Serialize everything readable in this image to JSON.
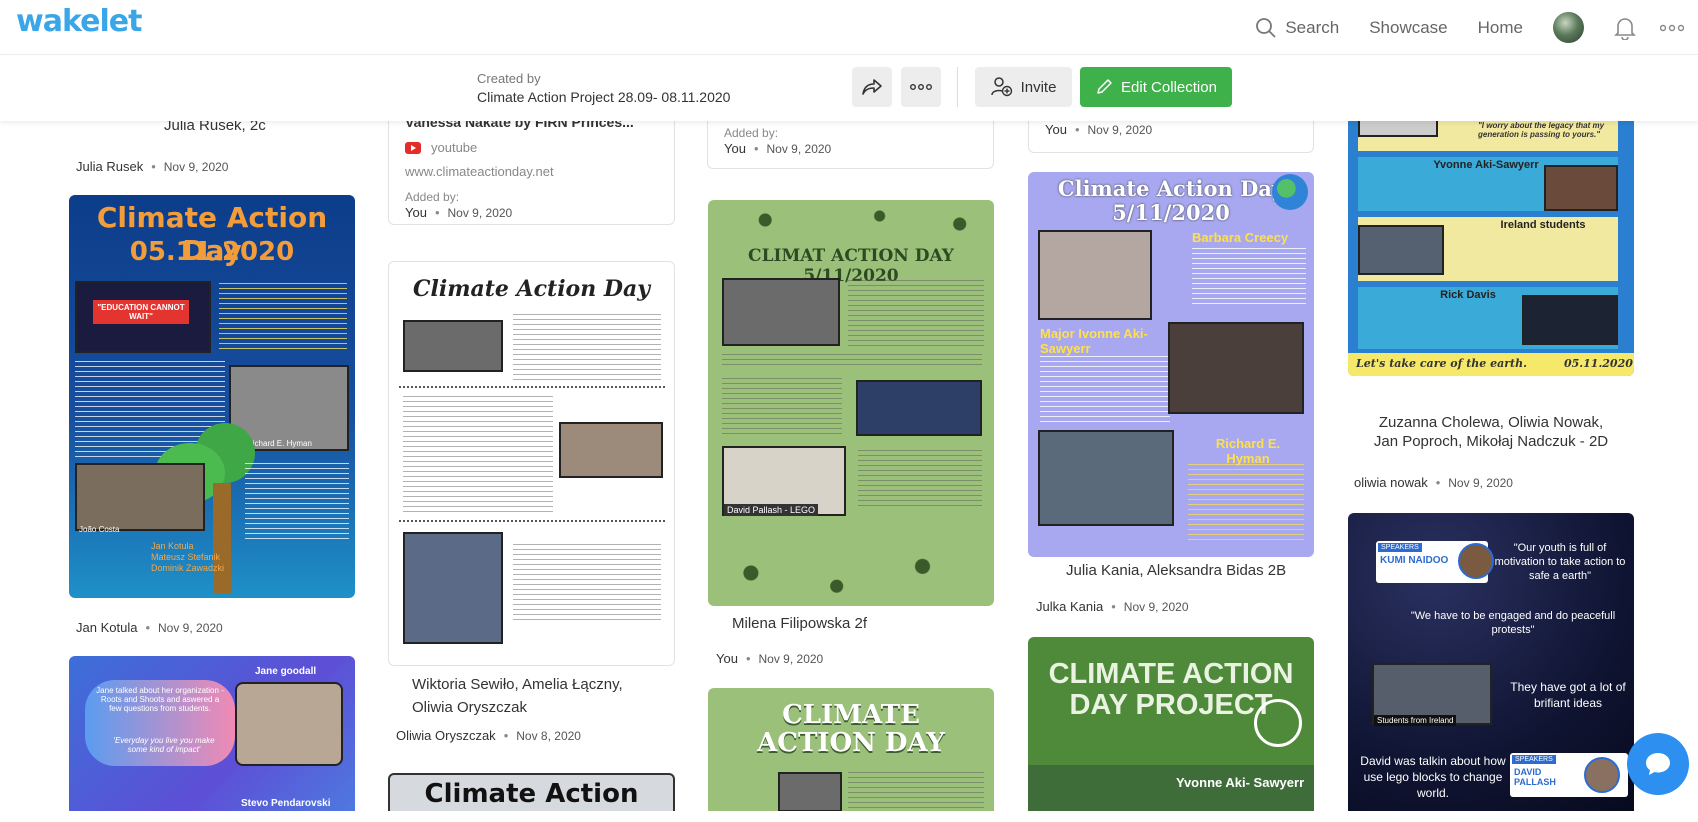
{
  "brand": {
    "logo_text": "wakelet"
  },
  "nav": {
    "search_label": "Search",
    "showcase_label": "Showcase",
    "home_label": "Home"
  },
  "collection": {
    "created_by_label": "Created by",
    "title": "Climate Action Project 28.09- 08.11.2020",
    "invite_label": "Invite",
    "edit_label": "Edit Collection"
  },
  "cards": {
    "c1_top_caption": "Julia Rusek, 2c",
    "c1_top_author": "Julia Rusek",
    "c1_top_date": "Nov 9, 2020",
    "c1_img_title_1": "Climate Action Day",
    "c1_img_title_2": "05.11.2020",
    "c1_img_badge": "\"EDUCATION CANNOT WAIT\"",
    "c1_img_names": "Jan Kotula\nMateusz Stefanik\nDominik Zawadzki",
    "c1_img_person_1": "Richard E. Hyman",
    "c1_img_person_2": "João Costa",
    "c1_bottom_author": "Jan Kotula",
    "c1_bottom_date": "Nov 9, 2020",
    "c1_img2_name_top": "Jane goodall",
    "c1_img2_text": "Jane talked about her organization - Roots and Shoots and aswered a few questions from students.",
    "c1_img2_quote": "'Everyday you live you make some kind of impact'",
    "c1_img2_name_bottom": "Stevo Pendarovski",
    "c2_link_title": "Vanessa Nakate by FIRN Princes...",
    "c2_link_source": "youtube",
    "c2_link_url": "www.climateactionday.net",
    "c2_added_by": "Added by:",
    "c2_added_user": "You",
    "c2_added_date": "Nov 9, 2020",
    "c2_img_title": "Climate Action Day",
    "c2_img_caption_1": "Wiktoria Sewiło, Amelia Łączny,",
    "c2_img_caption_2": "Oliwia Oryszczak",
    "c2_author": "Oliwia Oryszczak",
    "c2_date": "Nov 8, 2020",
    "c2_img2_title": "Climate Action",
    "c3_added_by": "Added by:",
    "c3_added_user": "You",
    "c3_added_date": "Nov 9, 2020",
    "c3_img_title": "CLIMAT ACTION DAY 5/11/2020",
    "c3_img_person": "David Pallash - LEGO",
    "c3_caption": "Milena Filipowska 2f",
    "c3_author": "You",
    "c3_date": "Nov 9, 2020",
    "c3_img2_title_1": "CLIMATE",
    "c3_img2_title_2": "ACTION DAY",
    "c4_top_author": "You",
    "c4_top_date": "Nov 9, 2020",
    "c4_img_title_1": "Climate Action Day",
    "c4_img_title_2": "5/11/2020",
    "c4_img_name_1": "Barbara Creecy",
    "c4_img_name_2": "Major Ivonne Aki-Sawyerr",
    "c4_img_name_3": "Richard E. Hyman",
    "c4_caption": "Julia Kania, Aleksandra Bidas 2B",
    "c4_author": "Julka Kania",
    "c4_date": "Nov 9, 2020",
    "c4_img2_title": "CLIMATE ACTION DAY PROJECT",
    "c4_img2_name": "Yvonne Aki- Sawyerr",
    "c5_img_quote": "\"I worry about the legacy that my generation is passing to yours.\"",
    "c5_img_name_1": "Yvonne Aki-Sawyerr",
    "c5_img_name_2": "Ireland students",
    "c5_img_name_3": "Rick Davis",
    "c5_img_footer_1": "Let's take care of the earth.",
    "c5_img_footer_2": "05.11.2020",
    "c5_caption_1": "Zuzanna Cholewa, Oliwia Nowak,",
    "c5_caption_2": "Jan Poproch, Mikołaj Nadczuk - 2D",
    "c5_author": "oliwia nowak",
    "c5_date": "Nov 9, 2020",
    "c5_img2_speaker_label": "SPEAKERS",
    "c5_img2_speaker_1": "KUMI NAIDOO",
    "c5_img2_quote_1": "\"Our youth is full of motivation to take action to safe a earth\"",
    "c5_img2_quote_2": "\"We have to be engaged and do peacefull protests\"",
    "c5_img2_text_1": "They have got a lot of brifiant ideas",
    "c5_img2_text_2": "David was talkin about how use lego blocks to change world.",
    "c5_img2_speaker_2": "DAVID PALLASH",
    "c5_img2_ireland": "Students from Ireland"
  },
  "colors": {
    "brand_blue": "#3aa6e8",
    "edit_green": "#3fb14a",
    "chat_blue": "#2d8ff0"
  }
}
